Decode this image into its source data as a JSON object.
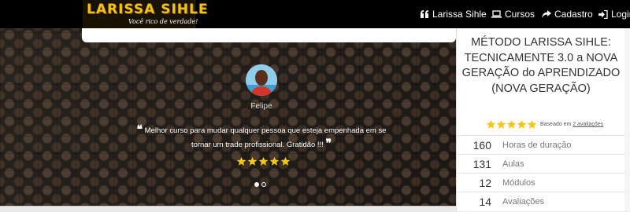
{
  "logo": {
    "title": "LARISSA SIHLE",
    "slogan": "Você rico de verdade!"
  },
  "nav": {
    "items": [
      {
        "label": "Larissa Sihle",
        "icon": "quote-icon"
      },
      {
        "label": "Cursos",
        "icon": "laptop-icon"
      },
      {
        "label": "Cadastro",
        "icon": "share-icon"
      },
      {
        "label": "Login",
        "icon": "login-icon"
      }
    ]
  },
  "testimonial": {
    "name": "Felipe",
    "quote": "Melhor curso para mudar qualquer pessoa que esteja empenhada em se tornar um trade profissional. Gratidão !!!",
    "stars": 5,
    "slides": 2,
    "active_slide": 1
  },
  "course": {
    "title": "MÉTODO LARISSA SIHLE: TECNICAMENTE 3.0 a NOVA GERAÇÃO do APRENDIZADO (NOVA GERAÇÃO)",
    "rating_stars": 5,
    "rating_prefix": "Baseado em",
    "rating_link": "2 avaliações",
    "stats": [
      {
        "value": "160",
        "label": "Horas de duração"
      },
      {
        "value": "131",
        "label": "Aulas"
      },
      {
        "value": "12",
        "label": "Módulos"
      },
      {
        "value": "14",
        "label": "Avaliações"
      }
    ]
  },
  "colors": {
    "star": "#f5c518",
    "logo_gold": "#f4c210",
    "navbar": "#000000"
  }
}
